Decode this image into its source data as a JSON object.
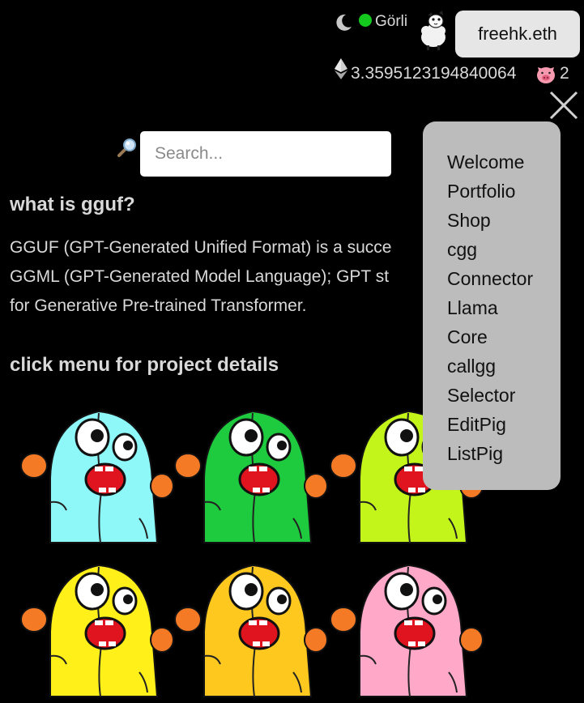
{
  "header": {
    "network_name": "Görli",
    "network_status_color": "#14c81e",
    "account_label": "freehk.eth",
    "balance": "3.3595123194840064",
    "pig_count": "2",
    "icons": [
      "moon-icon",
      "sheep-avatar-icon",
      "ethereum-icon",
      "pig-face-icon",
      "close-icon"
    ]
  },
  "search": {
    "placeholder": "Search...",
    "value": ""
  },
  "content": {
    "heading1": "what is gguf?",
    "paragraph_lines": [
      "GGUF (GPT-Generated Unified Format) is a succe",
      "GGML (GPT-Generated Model Language); GPT st",
      "for Generative Pre-trained Transformer."
    ],
    "heading2": "click menu for project details"
  },
  "menu": {
    "items": [
      "Welcome",
      "Portfolio",
      "Shop",
      "cgg",
      "Connector",
      "Llama",
      "Core",
      "callgg",
      "Selector",
      "EditPig",
      "ListPig"
    ]
  },
  "gallery": {
    "colors": [
      "#8ef8f8",
      "#1ecb3e",
      "#c4f51a",
      "#fff01a",
      "#ffc81e",
      "#ffa8c8"
    ]
  }
}
